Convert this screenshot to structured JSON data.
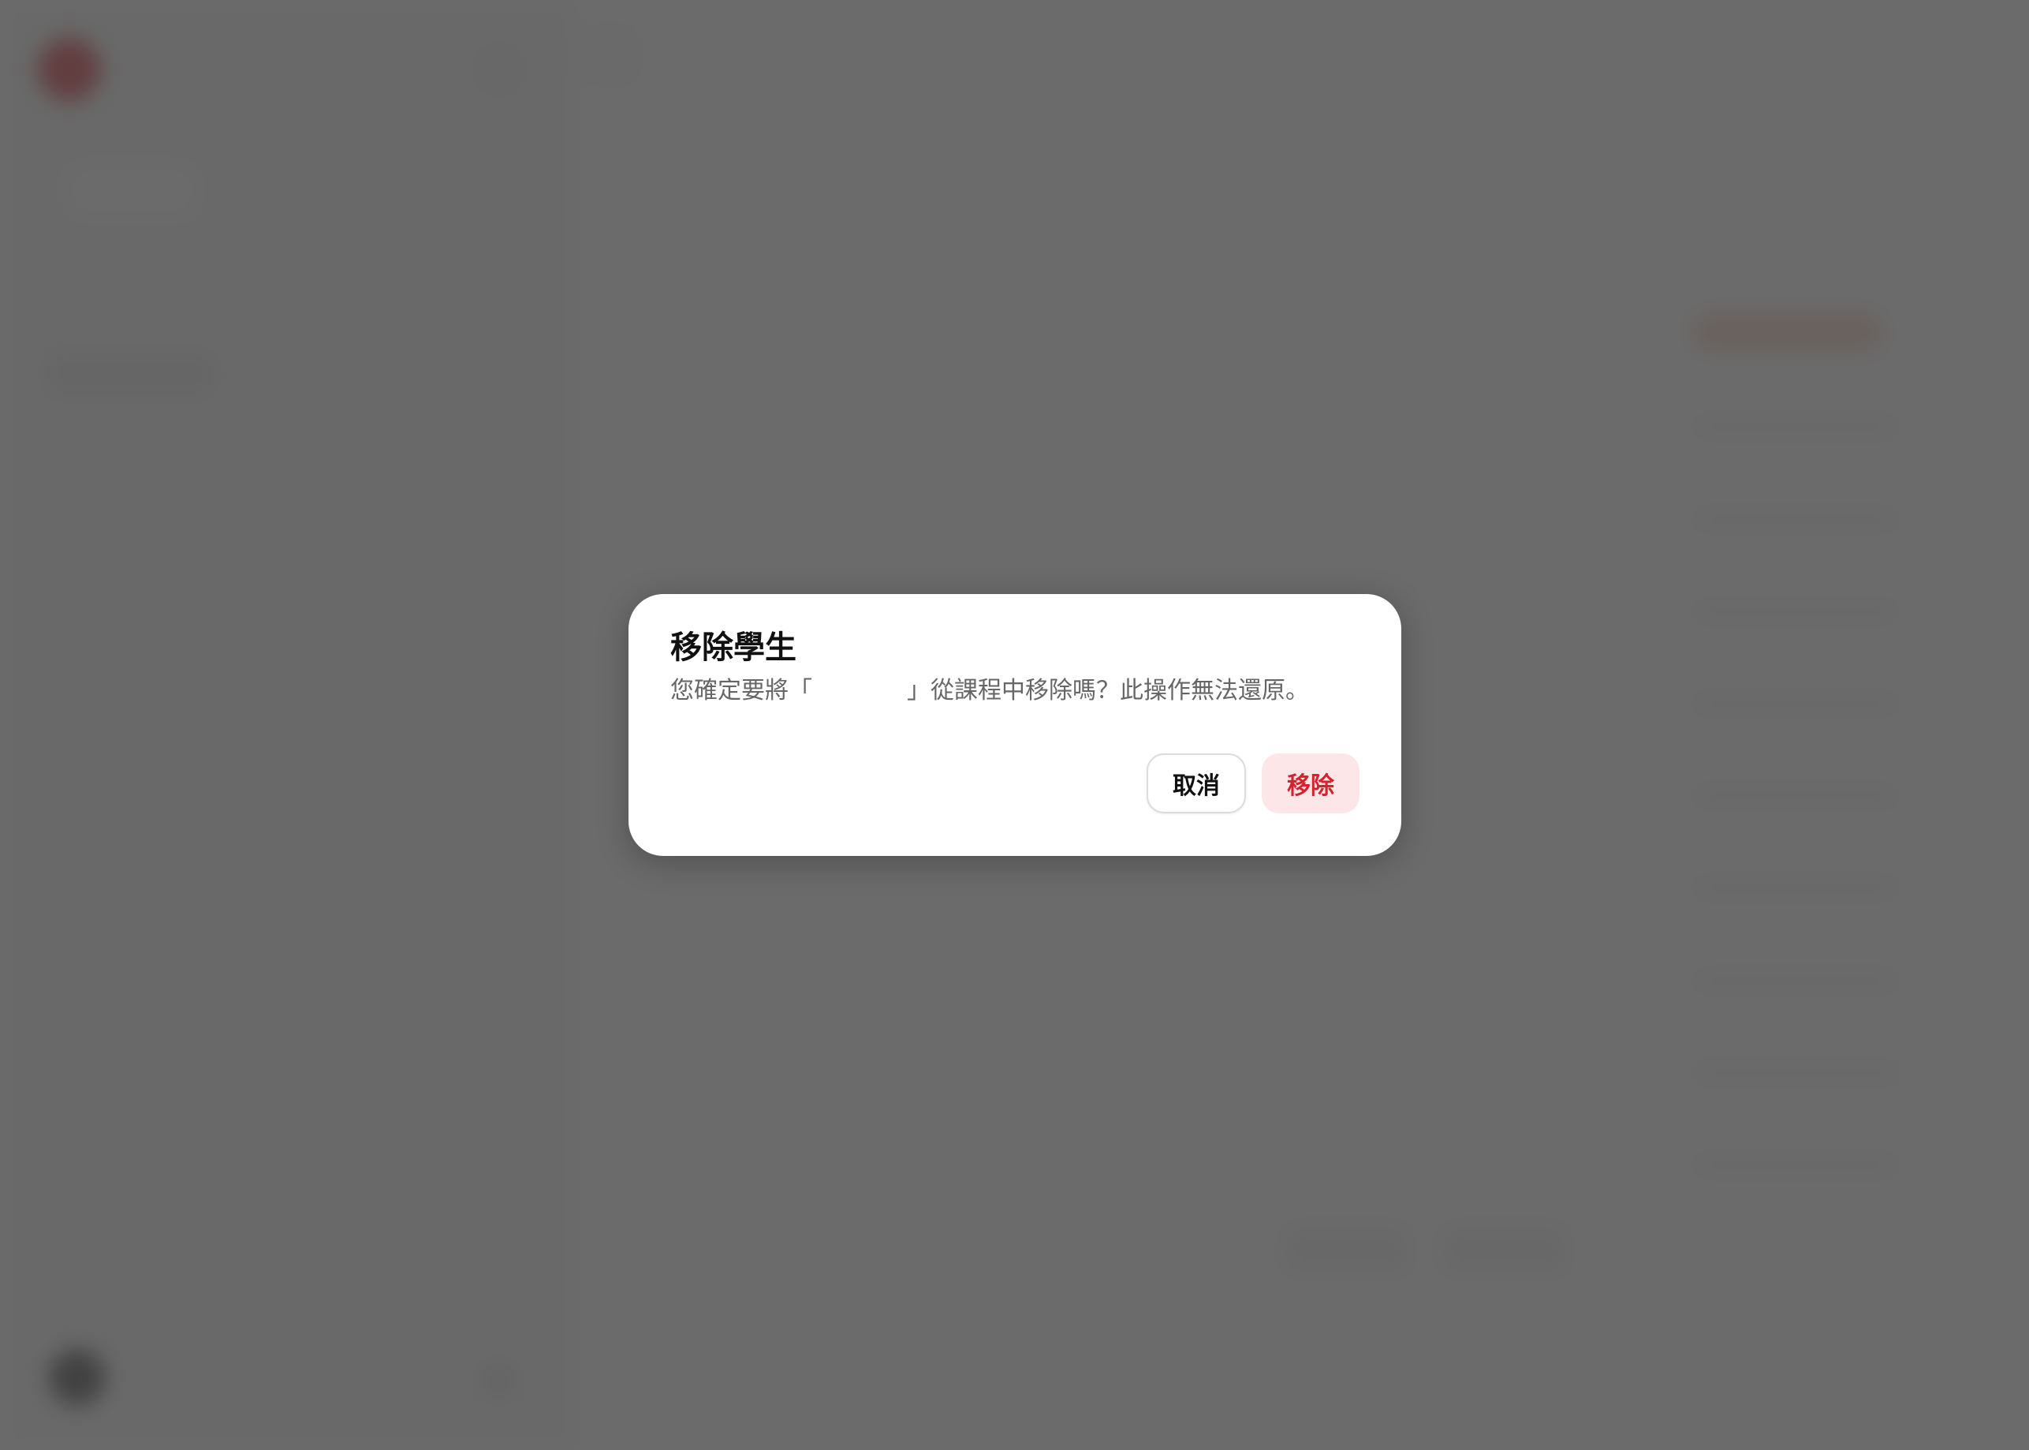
{
  "modal": {
    "title": "移除學生",
    "description": "您確定要將「　　　　」從課程中移除嗎？此操作無法還原。",
    "cancel_label": "取消",
    "remove_label": "移除"
  },
  "colors": {
    "overlay": "#676767",
    "danger_text": "#d2232f",
    "danger_bg": "#fde6e7",
    "brand": "#d0202a"
  }
}
